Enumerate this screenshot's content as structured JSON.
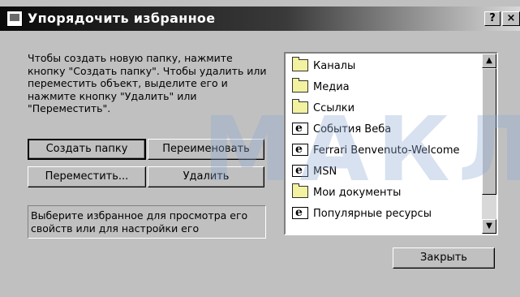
{
  "window": {
    "title": "Упорядочить избранное",
    "help_label": "?",
    "close_label": "×"
  },
  "description": "Чтобы создать новую папку, нажмите кнопку \"Создать папку\". Чтобы удалить или переместить объект, выделите его и нажмите кнопку \"Удалить\" или \"Переместить\".",
  "buttons": {
    "create_folder": "Создать папку",
    "rename": "Переименовать",
    "move": "Переместить...",
    "delete": "Удалить",
    "close": "Закрыть"
  },
  "info_text": "Выберите избранное для просмотра его свойств или для настройки его",
  "list": {
    "items": [
      {
        "label": "Каналы",
        "icon": "folder-icon"
      },
      {
        "label": "Медиа",
        "icon": "folder-icon"
      },
      {
        "label": "Ссылки",
        "icon": "folder-icon"
      },
      {
        "label": "События Веба",
        "icon": "web-page-icon"
      },
      {
        "label": "Ferrari Benvenuto-Welcome",
        "icon": "web-page-icon"
      },
      {
        "label": "MSN",
        "icon": "web-page-icon"
      },
      {
        "label": "Мои документы",
        "icon": "documents-folder-icon"
      },
      {
        "label": "Популярные ресурсы",
        "icon": "web-page-icon"
      }
    ]
  },
  "watermark": "МАКЛ",
  "colors": {
    "dialog_bg": "#c0c0c0",
    "titlebar_dark": "#0a0a0a",
    "titlebar_light": "#d8d8d8",
    "list_bg": "#ffffff"
  }
}
